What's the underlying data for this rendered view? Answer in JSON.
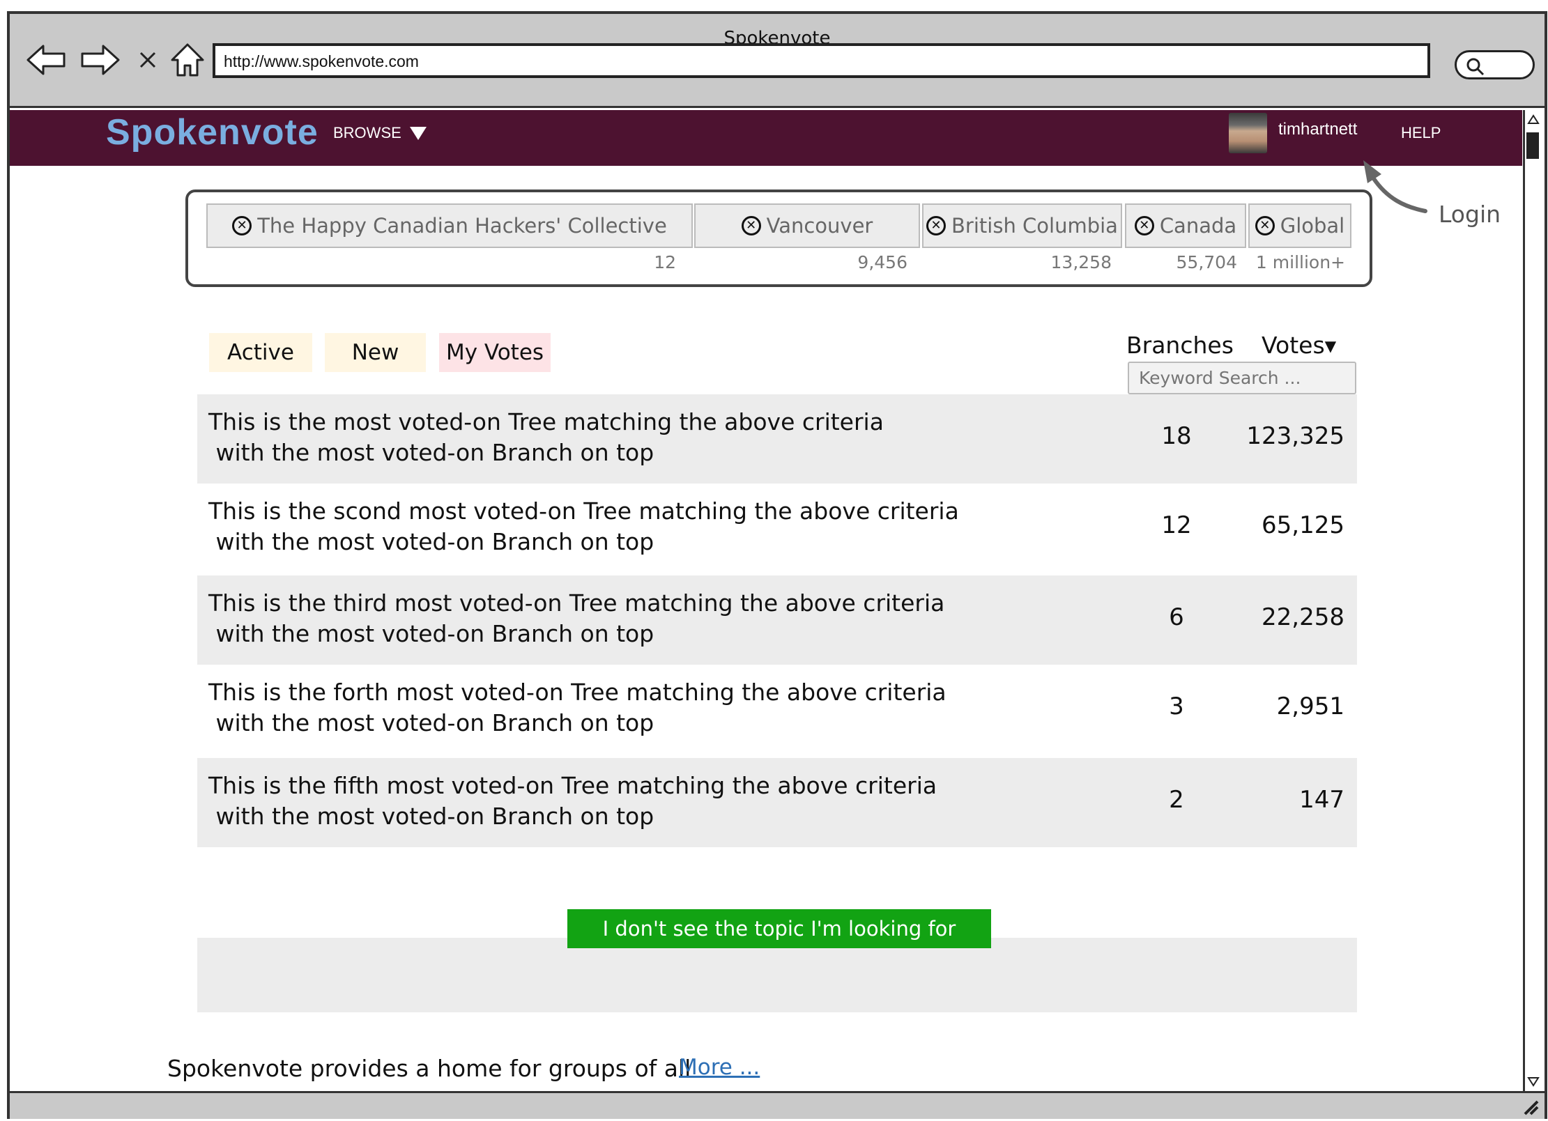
{
  "window": {
    "title": "Spokenvote",
    "url": "http://www.spokenvote.com"
  },
  "header": {
    "brand": "Spokenvote",
    "browse_label": "BROWSE",
    "username": "timhartnett",
    "help_label": "HELP"
  },
  "annotation": {
    "login": "Login"
  },
  "scopes": [
    {
      "label": "The Happy Canadian Hackers' Collective",
      "count": "12"
    },
    {
      "label": "Vancouver",
      "count": "9,456"
    },
    {
      "label": "British Columbia",
      "count": "13,258"
    },
    {
      "label": "Canada",
      "count": "55,704"
    },
    {
      "label": "Global",
      "count": "1 million+"
    }
  ],
  "tabs": {
    "active": "Active",
    "new": "New",
    "my_votes": "My Votes"
  },
  "columns": {
    "branches": "Branches",
    "votes": "Votes▾"
  },
  "search": {
    "placeholder": "Keyword Search ..."
  },
  "rows": [
    {
      "title": "This is the most voted-on Tree matching the above criteria",
      "subtitle": " with the most voted-on Branch on top",
      "branches": "18",
      "votes": "123,325"
    },
    {
      "title": "This is the scond most voted-on Tree matching the above criteria",
      "subtitle": " with the most voted-on Branch on top",
      "branches": "12",
      "votes": "65,125"
    },
    {
      "title": "This is the third most voted-on Tree matching the above criteria",
      "subtitle": " with the most voted-on Branch on top",
      "branches": "6",
      "votes": "22,258"
    },
    {
      "title": "This is the forth most voted-on Tree matching the above criteria",
      "subtitle": " with the most voted-on Branch on top",
      "branches": "3",
      "votes": "2,951"
    },
    {
      "title": "This is the fifth most voted-on Tree matching the above criteria",
      "subtitle": " with the most voted-on Branch on top",
      "branches": "2",
      "votes": "147"
    }
  ],
  "cta": {
    "label": "I don't see the topic I'm looking for"
  },
  "footer": {
    "text": "Spokenvote provides a home for groups of all",
    "more": "More ..."
  },
  "colors": {
    "header_bg": "#4d1230",
    "brand": "#7aaee0",
    "cta": "#12a313",
    "link": "#2d6fb5"
  }
}
